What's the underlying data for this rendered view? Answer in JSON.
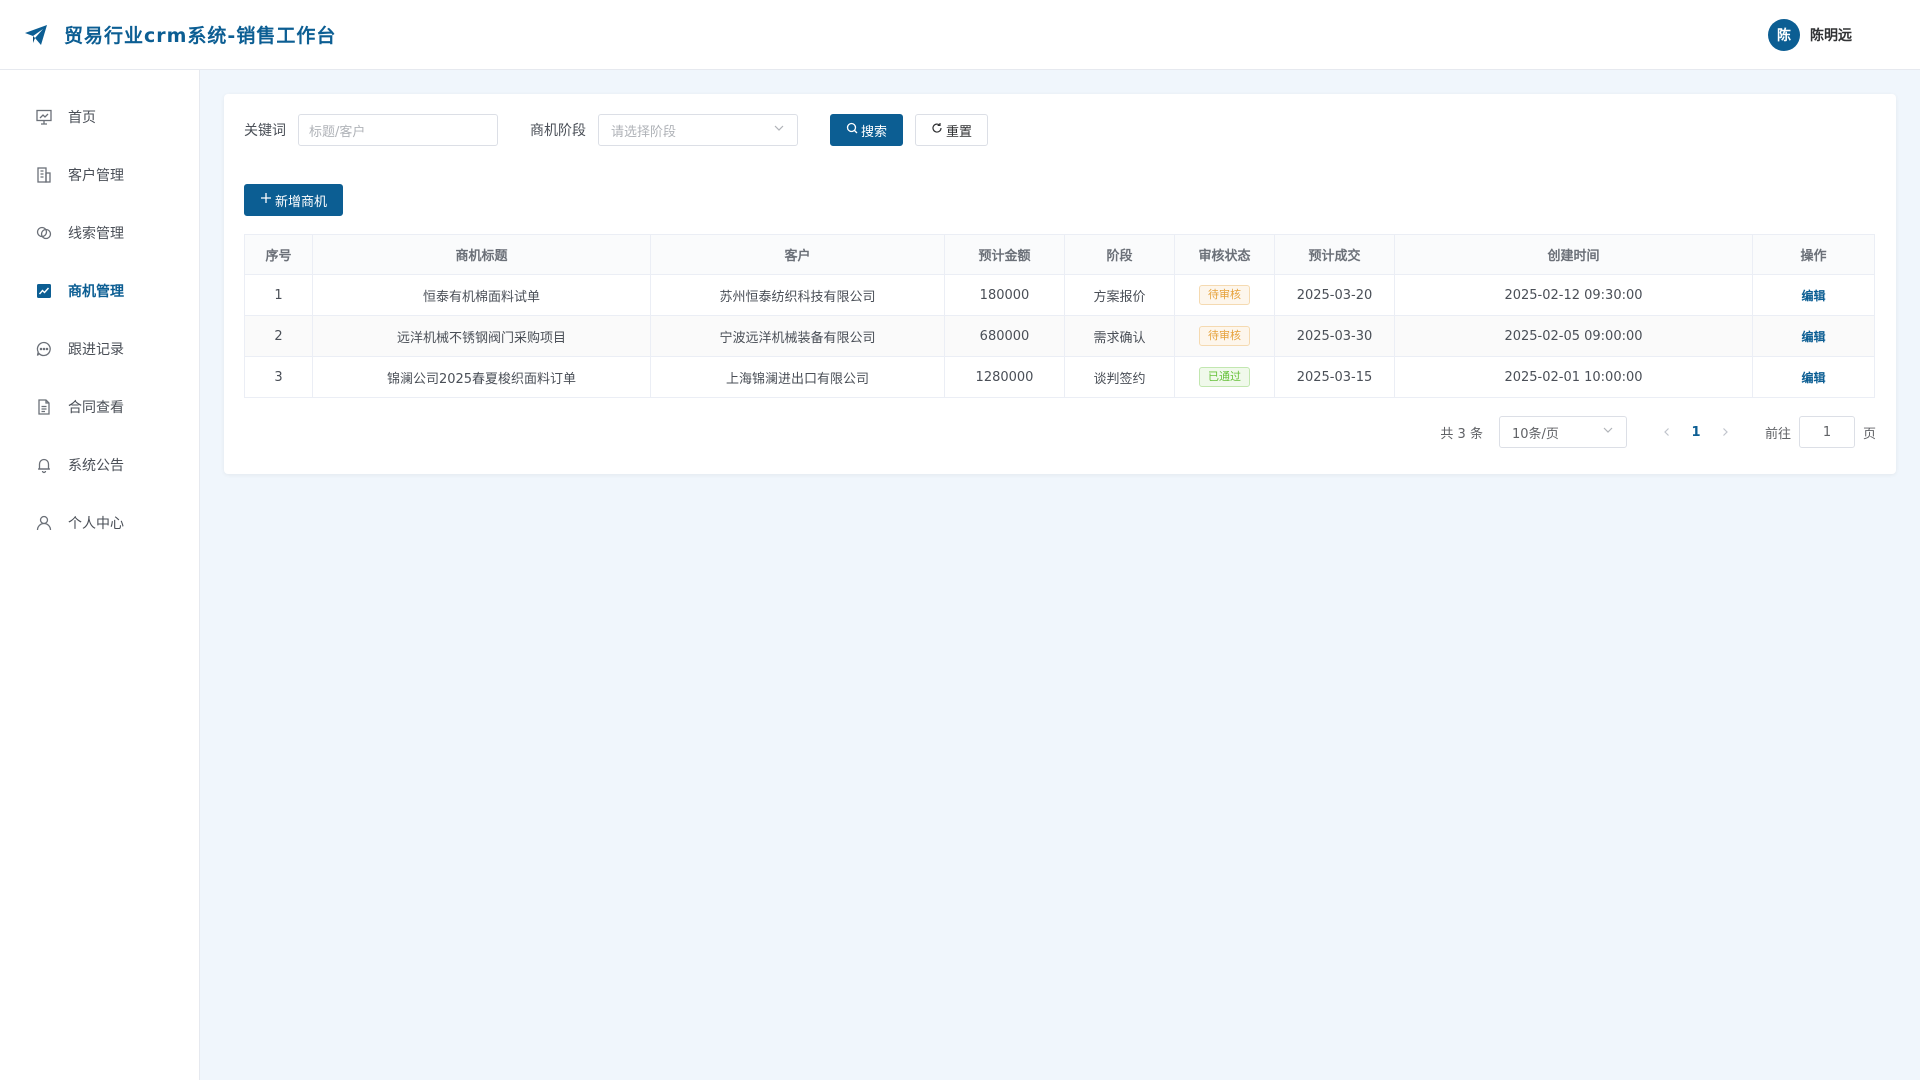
{
  "header": {
    "app_title": "贸易行业crm系统-销售工作台",
    "avatar_text": "陈",
    "user_name": "陈明远"
  },
  "sidebar": {
    "items": [
      {
        "label": "首页",
        "icon": "presentation-icon",
        "active": false
      },
      {
        "label": "客户管理",
        "icon": "building-icon",
        "active": false
      },
      {
        "label": "线索管理",
        "icon": "link-icon",
        "active": false
      },
      {
        "label": "商机管理",
        "icon": "trend-chart-icon",
        "active": true
      },
      {
        "label": "跟进记录",
        "icon": "chat-icon",
        "active": false
      },
      {
        "label": "合同查看",
        "icon": "document-icon",
        "active": false
      },
      {
        "label": "系统公告",
        "icon": "bell-icon",
        "active": false
      },
      {
        "label": "个人中心",
        "icon": "user-icon",
        "active": false
      }
    ]
  },
  "filters": {
    "keyword_label": "关键词",
    "keyword_placeholder": "标题/客户",
    "stage_label": "商机阶段",
    "stage_placeholder": "请选择阶段",
    "search_label": "搜索",
    "reset_label": "重置"
  },
  "toolbar": {
    "add_label": "新增商机"
  },
  "table": {
    "columns": [
      "序号",
      "商机标题",
      "客户",
      "预计金额",
      "阶段",
      "审核状态",
      "预计成交",
      "创建时间",
      "操作"
    ],
    "rows": [
      {
        "index": "1",
        "title": "恒泰有机棉面料试单",
        "customer": "苏州恒泰纺织科技有限公司",
        "amount": "180000",
        "stage": "方案报价",
        "status": "待审核",
        "status_type": "warn",
        "close_date": "2025-03-20",
        "created": "2025-02-12 09:30:00",
        "action": "编辑"
      },
      {
        "index": "2",
        "title": "远洋机械不锈钢阀门采购项目",
        "customer": "宁波远洋机械装备有限公司",
        "amount": "680000",
        "stage": "需求确认",
        "status": "待审核",
        "status_type": "warn",
        "close_date": "2025-03-30",
        "created": "2025-02-05 09:00:00",
        "action": "编辑"
      },
      {
        "index": "3",
        "title": "锦澜公司2025春夏梭织面料订单",
        "customer": "上海锦澜进出口有限公司",
        "amount": "1280000",
        "stage": "谈判签约",
        "status": "已通过",
        "status_type": "ok",
        "close_date": "2025-03-15",
        "created": "2025-02-01 10:00:00",
        "action": "编辑"
      }
    ]
  },
  "pagination": {
    "total_text": "共 3 条",
    "page_size": "10条/页",
    "current_page": "1",
    "goto_label": "前往",
    "goto_value": "1",
    "page_suffix": "页"
  },
  "colors": {
    "primary": "#0c5e93",
    "warn": "#e6a23c",
    "success": "#67c23a"
  }
}
